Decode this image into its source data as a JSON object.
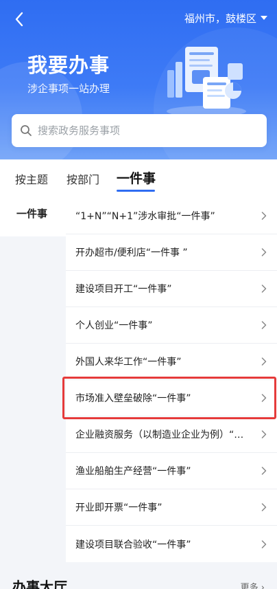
{
  "header": {
    "location": "福州市，鼓楼区",
    "title": "我要办事",
    "subtitle": "涉企事项一站办理"
  },
  "search": {
    "placeholder": "搜索政务服务事项"
  },
  "tabs": [
    {
      "label": "按主题",
      "active": false
    },
    {
      "label": "按部门",
      "active": false
    },
    {
      "label": "一件事",
      "active": true
    }
  ],
  "left_menu": {
    "items": [
      "一件事"
    ]
  },
  "list": {
    "items": [
      "“1+N”“N+1”涉水审批“一件事”",
      "开办超市/便利店“一件事 ”",
      "建设项目开工“一件事”",
      "个人创业“一件事”",
      "外国人来华工作“一件事”",
      "市场准入壁垒破除“一件事”",
      "企业融资服务（以制造业企业为例）“一件事”",
      "渔业船舶生产经营“一件事”",
      "开业即开票“一件事”",
      "建设项目联合验收“一件事”"
    ],
    "highlighted_index": 5
  },
  "bottom": {
    "section_title": "办事大厅",
    "more_label": "更多"
  },
  "colors": {
    "accent": "#2f6df2",
    "highlight": "#e53a3a"
  }
}
